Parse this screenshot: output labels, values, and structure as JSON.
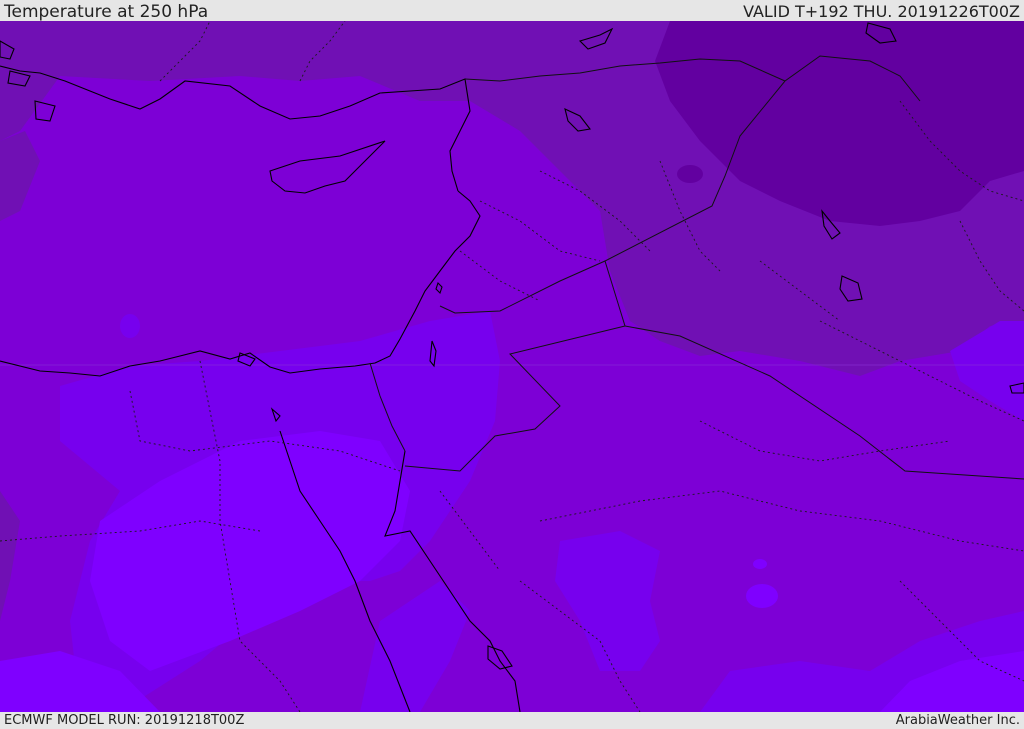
{
  "header": {
    "title": "Temperature at 250 hPa",
    "valid": "VALID T+192 THU. 20191226T00Z"
  },
  "footer": {
    "model_run": "ECMWF MODEL RUN: 20191218T00Z",
    "credit": "ArabiaWeather Inc."
  },
  "map": {
    "field_colors": {
      "coldest": "#6200a0",
      "cold": "#7010b4",
      "mid": "#7d00d6",
      "warm": "#7700ee",
      "warmest": "#7f00ff"
    },
    "coast_color": "#000000",
    "border_color": "#1a1a1a"
  }
}
